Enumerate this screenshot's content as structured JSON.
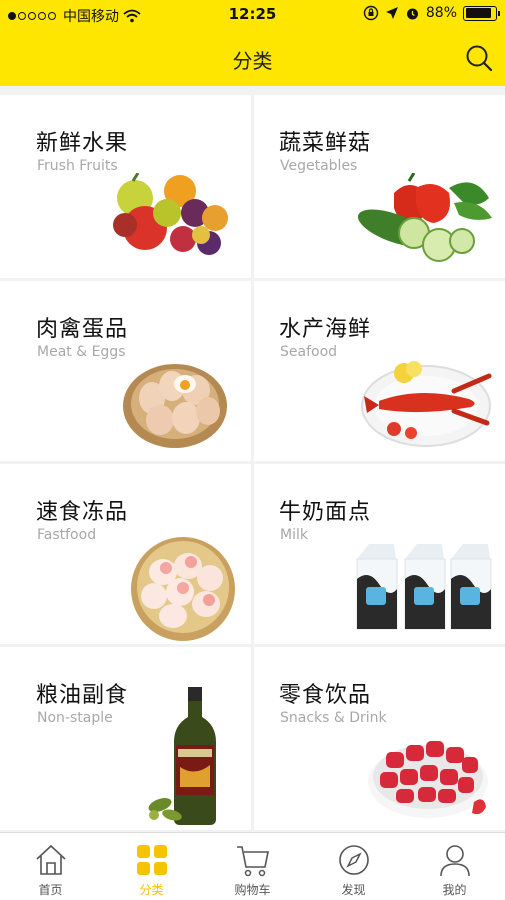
{
  "status_bar": {
    "carrier": "中国移动",
    "time": "12:25",
    "battery_percent": "88%",
    "battery_level": 0.88
  },
  "header": {
    "title": "分类",
    "search_icon": "search-icon",
    "background": "#ffe600"
  },
  "categories": [
    {
      "title": "新鲜水果",
      "subtitle": "Frush Fruits",
      "image": "fruits"
    },
    {
      "title": "蔬菜鲜菇",
      "subtitle": "Vegetables",
      "image": "vegetables"
    },
    {
      "title": "肉禽蛋品",
      "subtitle": "Meat & Eggs",
      "image": "eggs"
    },
    {
      "title": "水产海鲜",
      "subtitle": "Seafood",
      "image": "lobster"
    },
    {
      "title": "速食冻品",
      "subtitle": "Fastfood",
      "image": "buns"
    },
    {
      "title": "牛奶面点",
      "subtitle": "Milk",
      "image": "milk-cartons"
    },
    {
      "title": "粮油副食",
      "subtitle": "Non-staple",
      "image": "oil-bottle"
    },
    {
      "title": "零食饮品",
      "subtitle": "Snacks & Drink",
      "image": "dried-strawberries"
    }
  ],
  "tabbar": {
    "items": [
      {
        "label": "首页",
        "icon": "home-icon"
      },
      {
        "label": "分类",
        "icon": "grid-icon",
        "active": true
      },
      {
        "label": "购物车",
        "icon": "cart-icon"
      },
      {
        "label": "发现",
        "icon": "compass-icon"
      },
      {
        "label": "我的",
        "icon": "user-icon"
      }
    ],
    "active_color": "#f5c400"
  }
}
